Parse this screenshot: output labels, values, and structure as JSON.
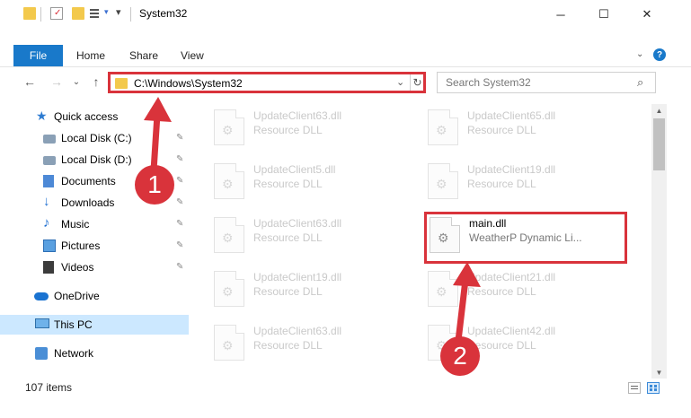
{
  "window": {
    "title": "System32",
    "minimize_glyph": "─",
    "maximize_glyph": "☐",
    "close_glyph": "✕"
  },
  "ribbon": {
    "file_tab": "File",
    "tabs": [
      "Home",
      "Share",
      "View"
    ],
    "help_glyph": "?"
  },
  "nav": {
    "back_glyph": "←",
    "forward_glyph": "→",
    "recent_glyph": "⌄",
    "up_glyph": "↑",
    "address": "C:\\Windows\\System32",
    "address_dropdown_glyph": "⌄",
    "refresh_glyph": "↻",
    "search_placeholder": "Search System32",
    "search_glyph": "⌕"
  },
  "sidebar": {
    "quick_access": "Quick access",
    "items": [
      {
        "label": "Local Disk (C:)",
        "icon": "drive-icon"
      },
      {
        "label": "Local Disk (D:)",
        "icon": "drive-icon"
      },
      {
        "label": "Documents",
        "icon": "documents-icon"
      },
      {
        "label": "Downloads",
        "icon": "downloads-icon"
      },
      {
        "label": "Music",
        "icon": "music-icon"
      },
      {
        "label": "Pictures",
        "icon": "pictures-icon"
      },
      {
        "label": "Videos",
        "icon": "videos-icon"
      }
    ],
    "pin_glyph": "📌",
    "onedrive": "OneDrive",
    "this_pc": "This PC",
    "network": "Network"
  },
  "files": [
    {
      "name": "UpdateClient63.dll",
      "type": "Resource DLL"
    },
    {
      "name": "UpdateClient65.dll",
      "type": "Resource DLL"
    },
    {
      "name": "UpdateClient5.dll",
      "type": "Resource DLL"
    },
    {
      "name": "UpdateClient19.dll",
      "type": "Resource DLL"
    },
    {
      "name": "UpdateClient63.dll",
      "type": "Resource DLL"
    },
    {
      "name": "main.dll",
      "type": "WeatherP Dynamic Li..."
    },
    {
      "name": "UpdateClient19.dll",
      "type": "Resource DLL"
    },
    {
      "name": "UpdateClient21.dll",
      "type": "Resource DLL"
    },
    {
      "name": "UpdateClient63.dll",
      "type": "Resource DLL"
    },
    {
      "name": "UpdateClient42.dll",
      "type": "Resource DLL"
    }
  ],
  "gear_glyph": "⚙",
  "status": {
    "item_count": "107 items"
  },
  "markers": {
    "step1": "1",
    "step2": "2"
  },
  "colors": {
    "accent": "#1979ca",
    "highlight": "#d9333b",
    "selected_bg": "#cce8ff"
  }
}
